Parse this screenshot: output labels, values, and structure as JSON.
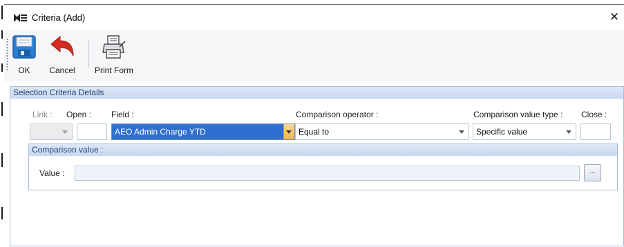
{
  "window": {
    "title": "Criteria (Add)",
    "close_glyph": "✕",
    "title_icon": "criteria-icon"
  },
  "toolbar": {
    "ok_label": "OK",
    "cancel_label": "Cancel",
    "print_label": "Print Form"
  },
  "panel": {
    "title": "Selection Criteria Details",
    "link_label": "Link :",
    "open_label": "Open :",
    "field_label": "Field :",
    "operator_label": "Comparison operator :",
    "value_type_label": "Comparison value type :",
    "close_label": "Close :",
    "link_value": "",
    "open_value": "",
    "field_value": "AEO Admin Charge YTD",
    "operator_value": "Equal to",
    "value_type_value": "Specific value",
    "close_value": ""
  },
  "comparison": {
    "title": "Comparison value :",
    "value_label": "Value :",
    "value": "",
    "browse_label": "..."
  },
  "colors": {
    "accent": "#2f6fd0",
    "header_bg": "#c8d9ef",
    "header_text": "#1f3f73",
    "cancel_red": "#d62b1f",
    "save_blue": "#2a7fd4"
  }
}
